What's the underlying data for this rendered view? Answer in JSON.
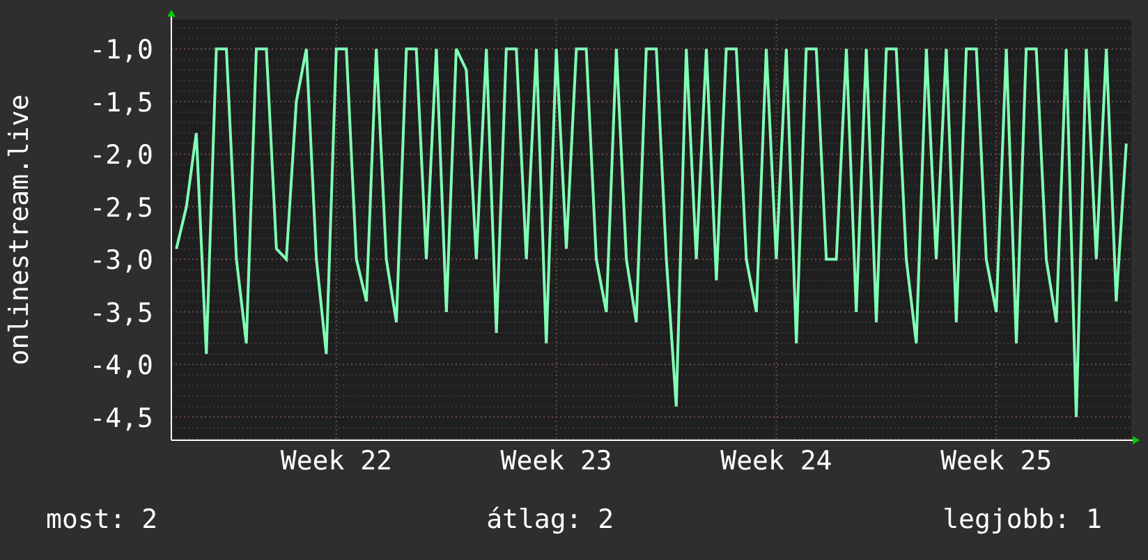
{
  "chart": {
    "chart_data": {
      "type": "line",
      "grid": true,
      "ylabel": "onlinestream.live",
      "ylim": [
        -4.72,
        -0.72
      ],
      "yticks": [
        {
          "value": -1,
          "label": "-1,0"
        },
        {
          "value": -1.5,
          "label": "-1,5"
        },
        {
          "value": -2,
          "label": "-2,0"
        },
        {
          "value": -2.5,
          "label": "-2,5"
        },
        {
          "value": -3,
          "label": "-3,0"
        },
        {
          "value": -3.5,
          "label": "-3,5"
        },
        {
          "value": -4,
          "label": "-4,0"
        },
        {
          "value": -4.5,
          "label": "-4,5"
        }
      ],
      "categories": [
        null,
        null,
        null,
        null,
        null,
        null,
        null,
        null,
        null,
        null,
        null,
        null,
        null,
        null,
        null,
        null,
        "Week 22",
        null,
        null,
        null,
        null,
        null,
        null,
        null,
        null,
        null,
        null,
        null,
        null,
        null,
        null,
        null,
        null,
        null,
        null,
        null,
        null,
        null,
        "Week 23",
        null,
        null,
        null,
        null,
        null,
        null,
        null,
        null,
        null,
        null,
        null,
        null,
        null,
        null,
        null,
        null,
        null,
        null,
        null,
        null,
        null,
        "Week 24",
        null,
        null,
        null,
        null,
        null,
        null,
        null,
        null,
        null,
        null,
        null,
        null,
        null,
        null,
        null,
        null,
        null,
        null,
        null,
        null,
        null,
        "Week 25",
        null,
        null,
        null,
        null,
        null,
        null,
        null,
        null,
        null,
        null,
        null,
        null,
        null
      ],
      "series": [
        {
          "color": "#80ffb4",
          "values": [
            -2.9,
            -2.5,
            -1.8,
            -3.9,
            -1.0,
            -1.0,
            -3.0,
            -3.8,
            -1.0,
            -1.0,
            -2.9,
            -3.0,
            -1.5,
            -1.0,
            -3.0,
            -3.9,
            -1.0,
            -1.0,
            -3.0,
            -3.4,
            -1.0,
            -3.0,
            -3.6,
            -1.0,
            -1.0,
            -3.0,
            -1.0,
            -3.5,
            -1.0,
            -1.2,
            -3.0,
            -1.0,
            -3.7,
            -1.0,
            -1.0,
            -3.0,
            -1.0,
            -3.8,
            -1.0,
            -2.9,
            -1.0,
            -1.0,
            -3.0,
            -3.5,
            -1.0,
            -3.0,
            -3.6,
            -1.0,
            -1.0,
            -3.0,
            -4.4,
            -1.0,
            -3.0,
            -1.0,
            -3.2,
            -1.0,
            -1.0,
            -3.0,
            -3.5,
            -1.0,
            -3.0,
            -1.0,
            -3.8,
            -1.0,
            -1.0,
            -3.0,
            -3.0,
            -1.0,
            -3.5,
            -1.0,
            -3.6,
            -1.0,
            -1.0,
            -3.0,
            -3.8,
            -1.0,
            -3.0,
            -1.0,
            -3.6,
            -1.0,
            -1.0,
            -3.0,
            -3.5,
            -1.0,
            -3.8,
            -1.0,
            -1.0,
            -3.0,
            -3.6,
            -1.0,
            -4.5,
            -1.0,
            -3.0,
            -1.0,
            -3.4,
            -1.9
          ]
        }
      ]
    }
  },
  "legend": [
    "most: 2",
    "átlag: 2",
    "legjobb: 1"
  ]
}
